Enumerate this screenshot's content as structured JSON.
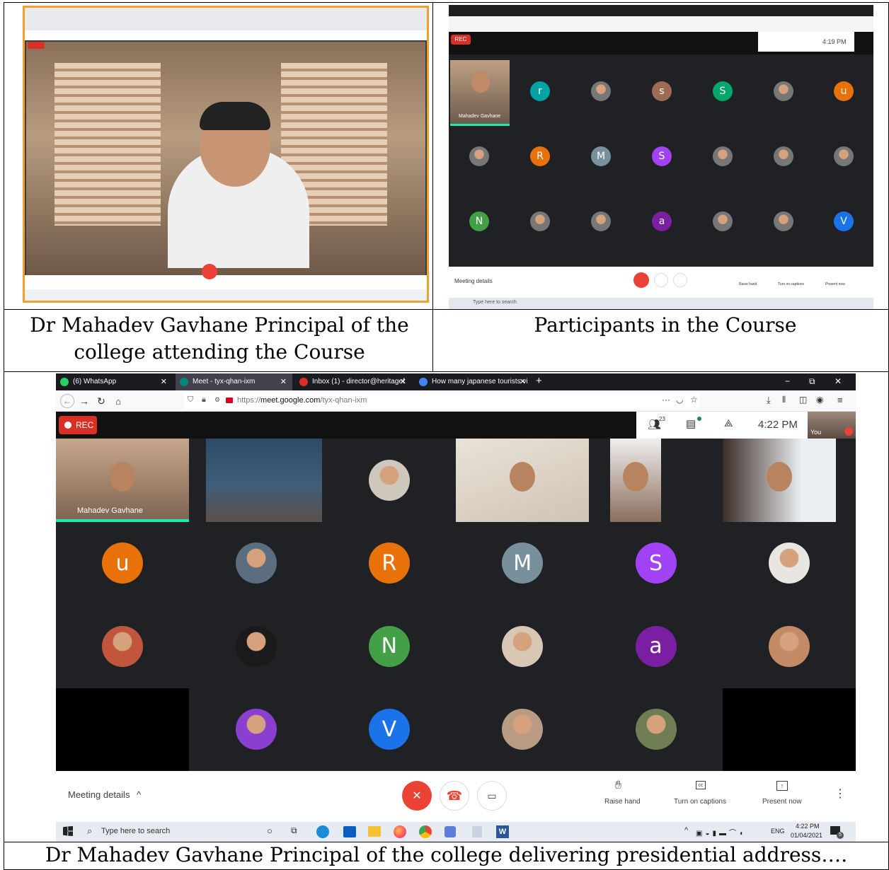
{
  "captions": {
    "top_left": "Dr Mahadev Gavhane Principal of the college attending the Course",
    "top_right": "Participants in the Course",
    "bottom": "Dr Mahadev Gavhane Principal of the college delivering presidential address…."
  },
  "browser": {
    "tabs": [
      {
        "label": "(6) WhatsApp",
        "icon": "whatsapp-icon",
        "color": "#25d366"
      },
      {
        "label": "Meet - tyx-qhan-ixm",
        "icon": "meet-icon",
        "color": "#00897b",
        "active": true
      },
      {
        "label": "Inbox (1) - director@heritagef",
        "icon": "gmail-icon",
        "color": "#d93025"
      },
      {
        "label": "How many japanese tourists vi",
        "icon": "chrome-icon",
        "color": "#4285f4"
      }
    ],
    "new_tab": "+",
    "url": "https://meet.google.com/tyx-qhan-ixm",
    "url_host": "meet.google.com",
    "url_prefix": "https://",
    "url_path": "/tyx-qhan-ixm",
    "url_dots": "···"
  },
  "meet": {
    "rec_label": "REC",
    "participants_count": "23",
    "time": "4:22 PM",
    "self_label": "You",
    "speaker_name": "Mahadev Gavhane",
    "meeting_details": "Meeting details",
    "raise_hand": "Raise hand",
    "captions": "Turn on captions",
    "present": "Present now",
    "avatars": [
      {
        "letter": "u",
        "color": "#e8710a"
      },
      {
        "letter": "R",
        "color": "#e8710a"
      },
      {
        "letter": "M",
        "color": "#78909c"
      },
      {
        "letter": "S",
        "color": "#a142f4"
      },
      {
        "letter": "N",
        "color": "#43a047"
      },
      {
        "letter": "a",
        "color": "#7b1fa2"
      },
      {
        "letter": "V",
        "color": "#1a73e8"
      }
    ],
    "accent": "#ea4335",
    "bg": "#202124"
  },
  "taskbar": {
    "search_placeholder": "Type here to search",
    "lang": "ENG",
    "time": "4:22 PM",
    "date": "01/04/2021",
    "notif_count": "5"
  },
  "small_right": {
    "rec_label": "REC",
    "time": "4:19 PM",
    "speaker_name": "Mahadev Gavhane",
    "meeting_details": "Meeting details",
    "raise_hand": "Raise hand",
    "captions": "Turn on captions",
    "present": "Present now",
    "search_placeholder": "Type here to search",
    "letters": [
      "r",
      "s",
      "S",
      "u",
      "R",
      "M",
      "S",
      "N",
      "a",
      "V"
    ]
  }
}
